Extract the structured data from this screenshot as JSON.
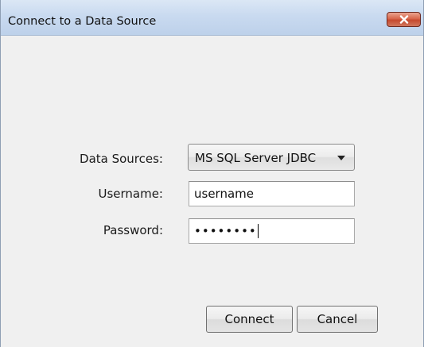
{
  "window": {
    "title": "Connect to a Data Source"
  },
  "icons": {
    "close": "close-icon",
    "dropdown": "chevron-down-icon"
  },
  "form": {
    "data_sources_label": "Data Sources:",
    "data_sources_selected": "MS SQL Server JDBC",
    "username_label": "Username:",
    "username_value": "username",
    "password_label": "Password:",
    "password_masked": "••••••••"
  },
  "buttons": {
    "connect_label": "Connect",
    "cancel_label": "Cancel"
  },
  "colors": {
    "titlebar": "#c9daf0",
    "close_button": "#d8664c",
    "dialog_background": "#f0f0f0"
  }
}
